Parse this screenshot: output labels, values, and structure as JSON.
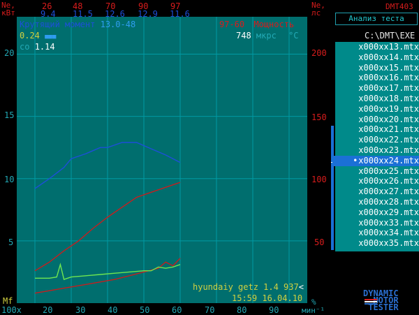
{
  "header": {
    "left_label_top": "Ne,",
    "left_label_bottom": "кВт",
    "right_label_top": "Ne,",
    "right_label_bottom": "лс",
    "app_name": "DMT403",
    "top_values": [
      "26",
      "48",
      "70",
      "90",
      "97"
    ],
    "sub_values": [
      "9.4",
      "11.5",
      "12.6",
      "12.9",
      "11.6"
    ]
  },
  "legend": {
    "torque_label": "Крутящий момент",
    "torque_range": "13.0-48",
    "power_range": "97-60",
    "power_label": "Мощность",
    "value_yellow": "0.24",
    "indicator": "■■■",
    "co_label": "co",
    "co_value": "1.14",
    "time_value": "748",
    "time_unit": "мкрс",
    "temp_unit": "°C"
  },
  "axes": {
    "left_ticks": [
      "20",
      "15",
      "10",
      "5"
    ],
    "right_ticks": [
      "200",
      "150",
      "100",
      "50"
    ],
    "x_ticks": [
      "20",
      "30",
      "40",
      "50",
      "60",
      "70",
      "80",
      "90"
    ],
    "x_prefix": "100x",
    "y_unit_bottom_left": "Mf",
    "x_unit_right": "мин⁻¹",
    "percent": "%"
  },
  "footer": {
    "vehicle": "hyundaiy getz 1.4 937",
    "datetime": "15:59 16.04.10"
  },
  "panel": {
    "title_button": "Анализ теста",
    "path": "C:\\DMT\\EXE",
    "files": [
      "x000xx13.mtx",
      "x000xx14.mtx",
      "x000xx15.mtx",
      "x000xx16.mtx",
      "x000xx17.mtx",
      "x000xx18.mtx",
      "x000xx19.mtx",
      "x000xx20.mtx",
      "x000xx21.mtx",
      "x000xx22.mtx",
      "x000xx23.mtx",
      "x000xx24.mtx",
      "x000xx25.mtx",
      "x000xx26.mtx",
      "x000xx27.mtx",
      "x000xx28.mtx",
      "x000xx29.mtx",
      "x000xx33.mtx",
      "x000xx34.mtx",
      "x000xx35.mtx"
    ],
    "selected": "x000xx24.mtx"
  },
  "logo": {
    "line1": "DYNAMIC",
    "line2": "MOTOR",
    "line3": "TESTER"
  },
  "colors": {
    "plot_bg": "#006e6e",
    "grid": "#009aa4",
    "torque": "#1d4fd8",
    "power": "#c81e1e",
    "green": "#6ee650",
    "selected": "#1b70d6"
  },
  "chart_data": {
    "type": "line",
    "xlabel": "мин⁻¹",
    "x_axis": [
      15,
      95
    ],
    "ylim_left": [
      0,
      23
    ],
    "ylim_right": [
      0,
      230
    ],
    "series": [
      {
        "name": "Крутящий момент",
        "axis": "left",
        "x": [
          20,
          24,
          28,
          30,
          34,
          38,
          40,
          44,
          48,
          52,
          56,
          60
        ],
        "y": [
          9.2,
          10.0,
          10.9,
          11.6,
          12.0,
          12.5,
          12.5,
          12.9,
          12.9,
          12.4,
          11.9,
          11.3
        ]
      },
      {
        "name": "Мощность",
        "axis": "right",
        "x": [
          20,
          24,
          28,
          32,
          36,
          40,
          44,
          48,
          52,
          56,
          60
        ],
        "y": [
          26,
          33,
          42,
          50,
          60,
          69,
          77,
          85,
          89,
          93,
          97
        ]
      },
      {
        "axis": "left",
        "x": [
          20,
          24,
          28,
          30,
          34,
          38,
          42,
          46,
          50,
          54,
          56,
          58,
          60
        ],
        "y": [
          0.8,
          1.0,
          1.2,
          1.3,
          1.5,
          1.7,
          1.9,
          2.2,
          2.5,
          2.8,
          3.3,
          3.0,
          3.6
        ]
      },
      {
        "axis": "left",
        "x": [
          20,
          24,
          26,
          27,
          28,
          30,
          34,
          38,
          42,
          46,
          50,
          52,
          54,
          56,
          58,
          60
        ],
        "y": [
          2.0,
          2.0,
          2.1,
          3.1,
          1.9,
          2.1,
          2.2,
          2.3,
          2.4,
          2.5,
          2.6,
          2.6,
          2.9,
          2.8,
          2.9,
          3.1
        ]
      }
    ]
  }
}
